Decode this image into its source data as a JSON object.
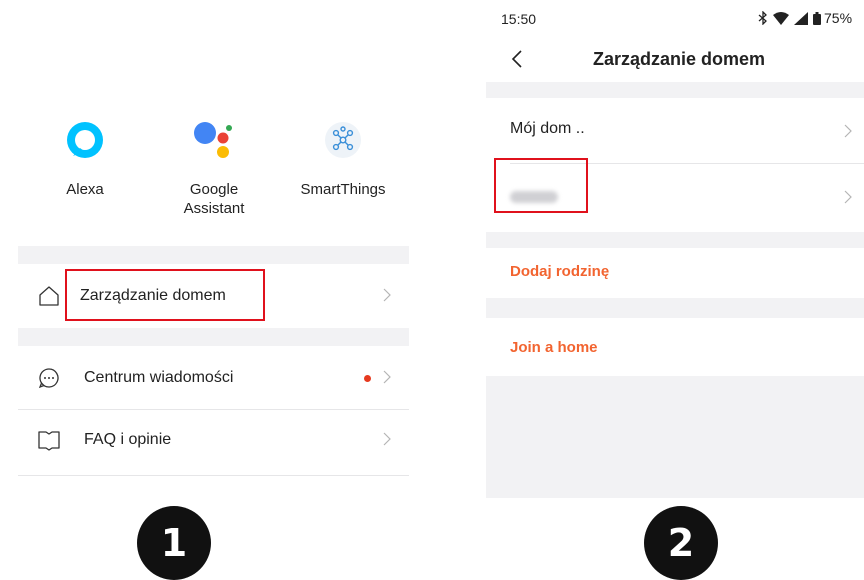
{
  "left": {
    "integrations": [
      {
        "label": "Alexa",
        "icon": "alexa-icon"
      },
      {
        "label": "Google\nAssistant",
        "icon": "google-assistant-icon"
      },
      {
        "label": "SmartThings",
        "icon": "smartthings-icon"
      }
    ],
    "menu": {
      "home_management": "Zarządzanie domem",
      "messages": "Centrum wiadomości",
      "faq": "FAQ i opinie"
    },
    "colors": {
      "notification_dot": "#e63a1f"
    },
    "step_number": "1"
  },
  "right": {
    "status_bar": {
      "time": "15:50",
      "battery": "75%"
    },
    "title": "Zarządzanie domem",
    "homes": [
      {
        "label": "Mój dom .."
      }
    ],
    "actions": {
      "add_family": "Dodaj rodzinę",
      "join_home": "Join a home"
    },
    "colors": {
      "accent": "#f26430"
    },
    "step_number": "2"
  },
  "colors": {
    "highlight": "#e0111c",
    "step_badge": "#111111"
  }
}
